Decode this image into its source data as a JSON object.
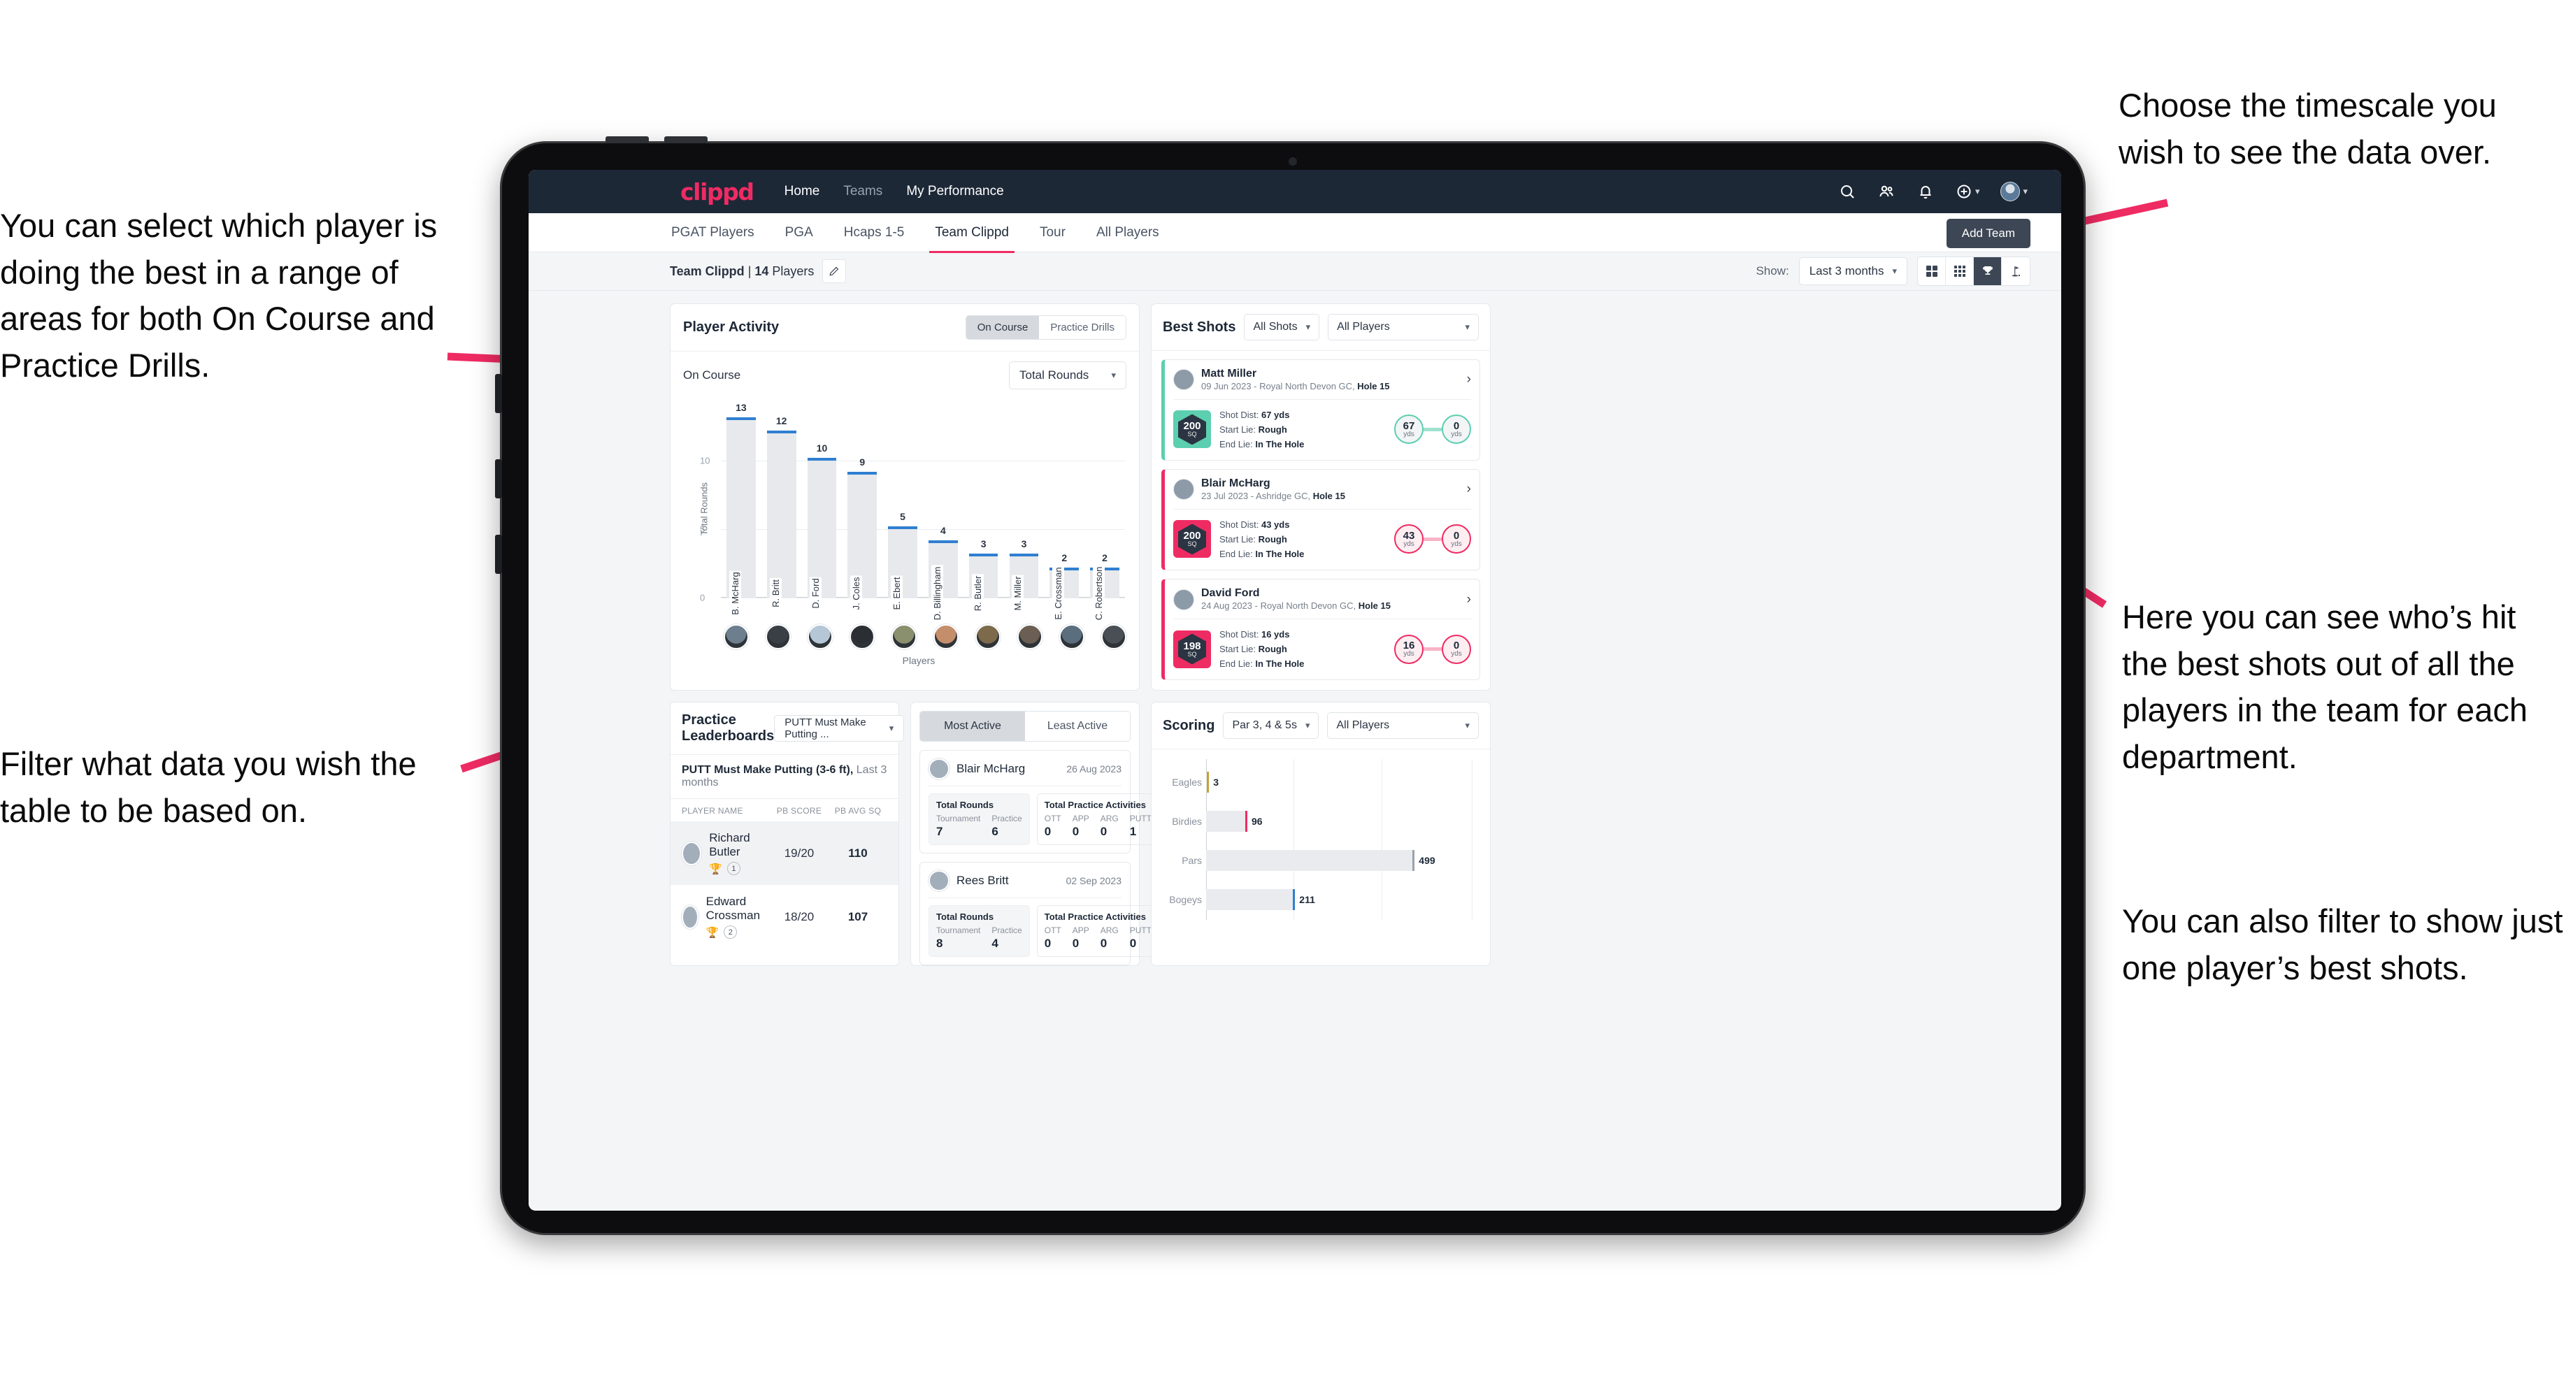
{
  "annotations": {
    "left_top": "You can select which player is doing the best in a range of areas for both On Course and Practice Drills.",
    "left_bottom": "Filter what data you wish the table to be based on.",
    "right_top": "Choose the timescale you wish to see the data over.",
    "right_mid": "Here you can see who’s hit the best shots out of all the players in the team for each department.",
    "right_bottom": "You can also filter to show just one player’s best shots."
  },
  "topnav": {
    "logo": "clippd",
    "links": [
      {
        "label": "Home",
        "active": true
      },
      {
        "label": "Teams",
        "active": false
      },
      {
        "label": "My Performance",
        "active": true
      }
    ],
    "icons": [
      "search-icon",
      "people-icon",
      "bell-icon",
      "plus-circle-icon",
      "avatar-icon"
    ]
  },
  "tabs": [
    {
      "label": "PGAT Players",
      "active": false
    },
    {
      "label": "PGA",
      "active": false
    },
    {
      "label": "Hcaps 1-5",
      "active": false
    },
    {
      "label": "Team Clippd",
      "active": true
    },
    {
      "label": "Tour",
      "active": false
    },
    {
      "label": "All Players",
      "active": false
    }
  ],
  "add_team_label": "Add Team",
  "subbar": {
    "team_name": "Team Clippd",
    "separator": " | ",
    "player_count": "14",
    "players_word": " Players",
    "show_label": "Show:",
    "timescale_value": "Last 3 months",
    "view_icons": [
      {
        "name": "grid-2x2-icon",
        "active": false
      },
      {
        "name": "grid-3x3-icon",
        "active": false
      },
      {
        "name": "trophy-icon",
        "active": true
      },
      {
        "name": "flag-icon",
        "active": false
      }
    ]
  },
  "player_activity": {
    "title": "Player Activity",
    "segments": [
      {
        "label": "On Course",
        "active": true
      },
      {
        "label": "Practice Drills",
        "active": false
      }
    ],
    "sub_label": "On Course",
    "metric_value": "Total Rounds"
  },
  "chart_data": [
    {
      "type": "bar",
      "title": "Player Activity – On Course",
      "xlabel": "Players",
      "ylabel": "Total Rounds",
      "ylim": [
        0,
        13.5
      ],
      "yticks": [
        "0",
        "5",
        "10"
      ],
      "grid": true,
      "categories": [
        "B. McHarg",
        "R. Britt",
        "D. Ford",
        "J. Coles",
        "E. Ebert",
        "D. Billingham",
        "R. Butler",
        "M. Miller",
        "E. Crossman",
        "C. Robertson"
      ],
      "values": [
        13,
        12,
        10,
        9,
        5,
        4,
        3,
        3,
        2,
        2
      ],
      "bar_color": "#e7e9ec",
      "cap_color": "#2f7fd1"
    },
    {
      "type": "bar",
      "orientation": "horizontal",
      "title": "Scoring",
      "xlabel": "",
      "ylabel": "",
      "categories": [
        "Eagles",
        "Birdies",
        "Pars",
        "Bogeys"
      ],
      "values": [
        3,
        96,
        499,
        211
      ],
      "value_labels": [
        "3",
        "96",
        "499",
        "211"
      ],
      "bar_color": "#e9ebee",
      "end_colors": [
        "#c2a13c",
        "#ef2b63",
        "#9aa2ad",
        "#2f7fd1"
      ],
      "xmax": 640,
      "grid": true
    }
  ],
  "best_shots": {
    "title": "Best Shots",
    "filter_shots": "All Shots",
    "filter_players": "All Players",
    "cards": [
      {
        "player": "Matt Miller",
        "meta_plain": "09 Jun 2023 - Royal North Devon GC, ",
        "meta_bold": "Hole 15",
        "badge_number": "200",
        "badge_unit": "SQ",
        "accent": "teal",
        "shot_dist_label": "Shot Dist: ",
        "shot_dist_value": "67 yds",
        "start_lie_label": "Start Lie: ",
        "start_lie_value": "Rough",
        "end_lie_label": "End Lie: ",
        "end_lie_value": "In The Hole",
        "from_value": "67",
        "from_unit": "yds",
        "to_value": "0",
        "to_unit": "yds"
      },
      {
        "player": "Blair McHarg",
        "meta_plain": "23 Jul 2023 - Ashridge GC, ",
        "meta_bold": "Hole 15",
        "badge_number": "200",
        "badge_unit": "SQ",
        "accent": "pink",
        "shot_dist_label": "Shot Dist: ",
        "shot_dist_value": "43 yds",
        "start_lie_label": "Start Lie: ",
        "start_lie_value": "Rough",
        "end_lie_label": "End Lie: ",
        "end_lie_value": "In The Hole",
        "from_value": "43",
        "from_unit": "yds",
        "to_value": "0",
        "to_unit": "yds"
      },
      {
        "player": "David Ford",
        "meta_plain": "24 Aug 2023 - Royal North Devon GC, ",
        "meta_bold": "Hole 15",
        "badge_number": "198",
        "badge_unit": "SQ",
        "accent": "pink",
        "shot_dist_label": "Shot Dist: ",
        "shot_dist_value": "16 yds",
        "start_lie_label": "Start Lie: ",
        "start_lie_value": "Rough",
        "end_lie_label": "End Lie: ",
        "end_lie_value": "In The Hole",
        "from_value": "16",
        "from_unit": "yds",
        "to_value": "0",
        "to_unit": "yds"
      }
    ]
  },
  "practice_leaderboards": {
    "title": "Practice Leaderboards",
    "drill_value": "PUTT Must Make Putting ...",
    "sub_bold": "PUTT Must Make Putting (3-6 ft),",
    "sub_plain": " Last 3 months",
    "columns": [
      "PLAYER NAME",
      "PB SCORE",
      "PB AVG SQ"
    ],
    "rows": [
      {
        "name": "Richard Butler",
        "rank": "1",
        "trophy": "gold",
        "pb_score": "19/20",
        "pb_avg_sq": "110",
        "highlight": true
      },
      {
        "name": "Edward Crossman",
        "rank": "2",
        "trophy": "silver",
        "pb_score": "18/20",
        "pb_avg_sq": "107",
        "highlight": false
      }
    ]
  },
  "activity": {
    "tabs": [
      {
        "label": "Most Active",
        "active": true
      },
      {
        "label": "Least Active",
        "active": false
      }
    ],
    "cards": [
      {
        "name": "Blair McHarg",
        "date": "26 Aug 2023",
        "rounds_title": "Total Rounds",
        "rounds_keys": [
          "Tournament",
          "Practice"
        ],
        "rounds_values": [
          "7",
          "6"
        ],
        "practice_title": "Total Practice Activities",
        "practice_keys": [
          "OTT",
          "APP",
          "ARG",
          "PUTT"
        ],
        "practice_values": [
          "0",
          "0",
          "0",
          "1"
        ]
      },
      {
        "name": "Rees Britt",
        "date": "02 Sep 2023",
        "rounds_title": "Total Rounds",
        "rounds_keys": [
          "Tournament",
          "Practice"
        ],
        "rounds_values": [
          "8",
          "4"
        ],
        "practice_title": "Total Practice Activities",
        "practice_keys": [
          "OTT",
          "APP",
          "ARG",
          "PUTT"
        ],
        "practice_values": [
          "0",
          "0",
          "0",
          "0"
        ]
      }
    ]
  },
  "scoring": {
    "title": "Scoring",
    "filter_par": "Par 3, 4 & 5s",
    "filter_players": "All Players"
  },
  "colors": {
    "brand_pink": "#ef2b63",
    "nav_dark": "#1d2837",
    "bar_blue": "#2f7fd1",
    "teal": "#5ccfb0",
    "gold": "#c2a13c"
  }
}
